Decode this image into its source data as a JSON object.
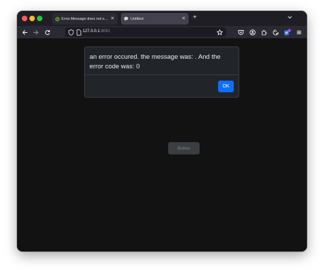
{
  "browser": {
    "tabs": [
      {
        "title": "Error.Message does not show t",
        "close_icon": "close-icon",
        "icon": "globe-icon"
      },
      {
        "title": "Untitled",
        "close_icon": "close-icon",
        "icon": "chat-icon"
      }
    ],
    "new_tab_label": "+",
    "url": {
      "host": "127.0.0.1",
      "port": ":8081"
    },
    "toolbar_icons": [
      "back-icon",
      "forward-icon",
      "reload-icon",
      "shield-icon",
      "page-icon",
      "star-icon",
      "pocket-icon",
      "account-icon",
      "extensions-icon",
      "theme-icon",
      "addon-icon",
      "menu-icon"
    ],
    "addon_badge": "2"
  },
  "modal": {
    "message": "an error occured. the message was: . And the error code was: 0",
    "ok_label": "OK"
  },
  "page": {
    "button_label": "Button"
  },
  "colors": {
    "accent": "#0d6efd",
    "page_background": "#121212",
    "modal_background": "#212529"
  }
}
